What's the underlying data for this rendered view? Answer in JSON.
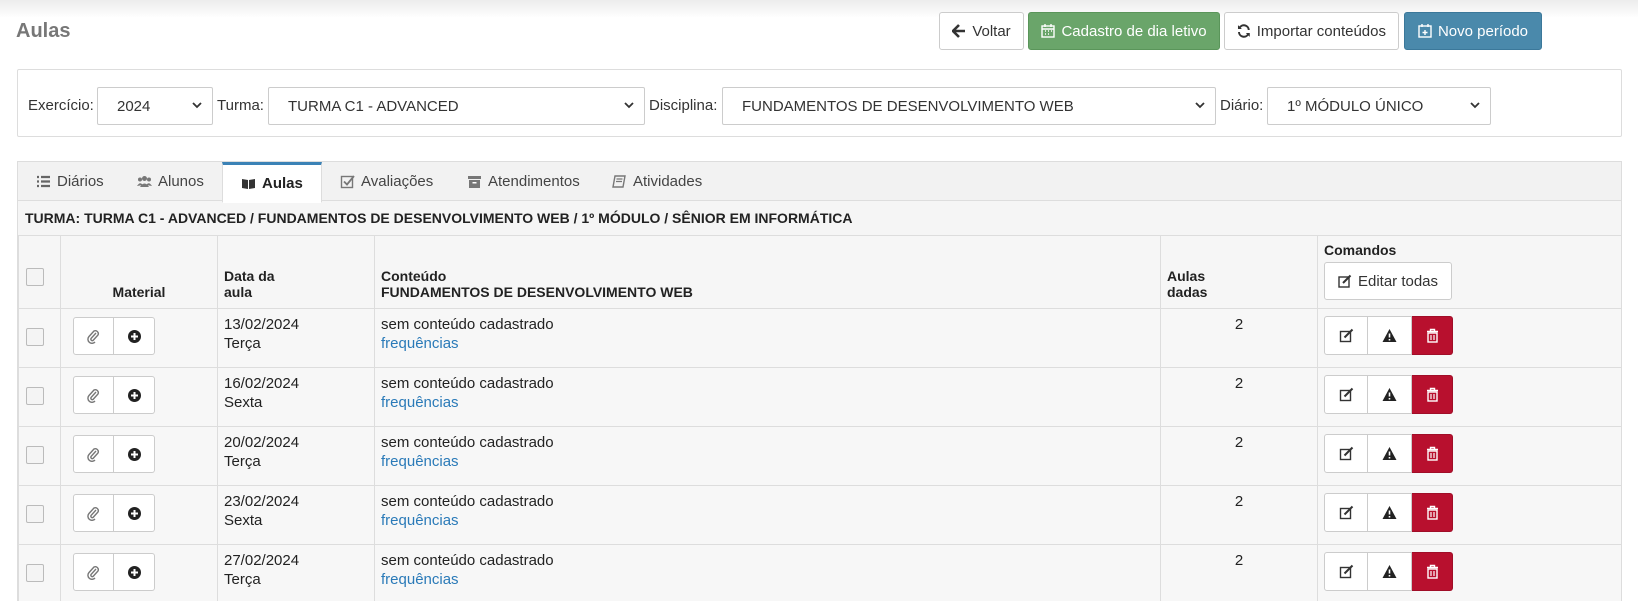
{
  "page": {
    "title": "Aulas"
  },
  "toolbar": {
    "back_label": "Voltar",
    "school_day_label": "Cadastro de dia letivo",
    "import_label": "Importar conteúdos",
    "new_period_label": "Novo período"
  },
  "filters": {
    "exercicio_label": "Exercício:",
    "exercicio_value": "2024",
    "turma_label": "Turma:",
    "turma_value": "TURMA C1 - ADVANCED",
    "disciplina_label": "Disciplina:",
    "disciplina_value": "FUNDAMENTOS DE DESENVOLVIMENTO WEB",
    "diario_label": "Diário:",
    "diario_value": "1º MÓDULO ÚNICO"
  },
  "tabs": [
    {
      "label": "Diários",
      "icon": "list-icon"
    },
    {
      "label": "Alunos",
      "icon": "users-icon"
    },
    {
      "label": "Aulas",
      "icon": "book-open-icon",
      "active": true
    },
    {
      "label": "Avaliações",
      "icon": "check-square-icon"
    },
    {
      "label": "Atendimentos",
      "icon": "archive-icon"
    },
    {
      "label": "Atividades",
      "icon": "book-icon"
    }
  ],
  "breadcrumb": "TURMA: TURMA C1 - ADVANCED / FUNDAMENTOS DE DESENVOLVIMENTO WEB / 1º MÓDULO / SÊNIOR EM INFORMÁTICA",
  "table": {
    "headers": {
      "material": "Material",
      "date_l1": "Data da",
      "date_l2": "aula",
      "content_l1": "Conteúdo",
      "content_l2": "FUNDAMENTOS DE DESENVOLVIMENTO WEB",
      "aulas_l1": "Aulas",
      "aulas_l2": "dadas",
      "commands": "Comandos",
      "edit_all": "Editar todas"
    },
    "rows": [
      {
        "date": "13/02/2024",
        "weekday": "Terça",
        "content": "sem conteúdo cadastrado",
        "link": "frequências",
        "aulas": "2"
      },
      {
        "date": "16/02/2024",
        "weekday": "Sexta",
        "content": "sem conteúdo cadastrado",
        "link": "frequências",
        "aulas": "2"
      },
      {
        "date": "20/02/2024",
        "weekday": "Terça",
        "content": "sem conteúdo cadastrado",
        "link": "frequências",
        "aulas": "2"
      },
      {
        "date": "23/02/2024",
        "weekday": "Sexta",
        "content": "sem conteúdo cadastrado",
        "link": "frequências",
        "aulas": "2"
      },
      {
        "date": "27/02/2024",
        "weekday": "Terça",
        "content": "sem conteúdo cadastrado",
        "link": "frequências",
        "aulas": "2"
      }
    ]
  },
  "colors": {
    "green": "#6aa56a",
    "blue": "#4a89ab",
    "danger": "#b8102e",
    "link": "#2a7ab8"
  }
}
